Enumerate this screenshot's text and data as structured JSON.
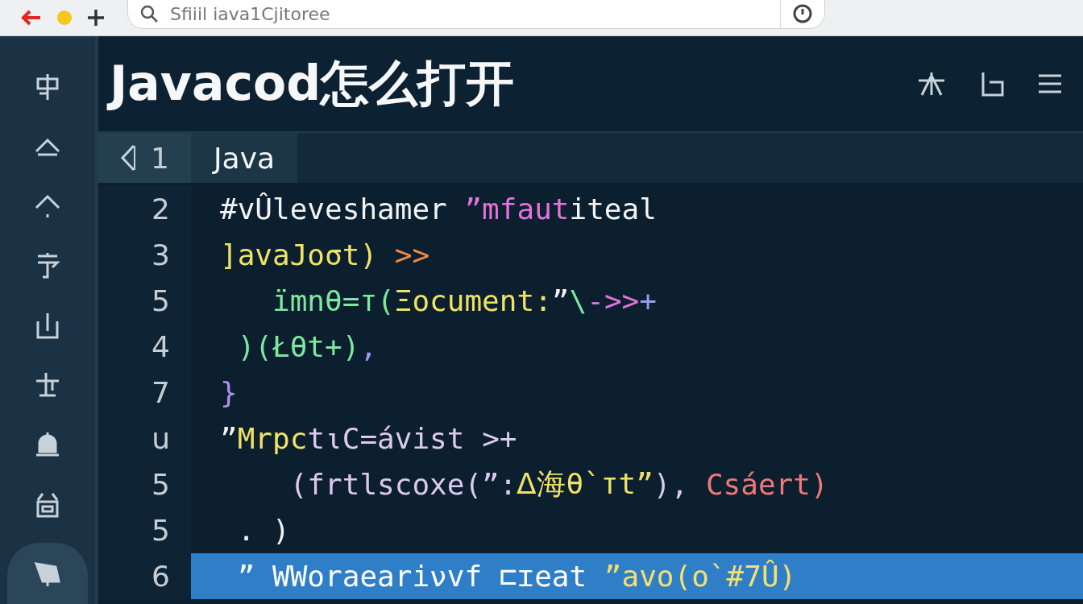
{
  "browser": {
    "address": "Sfiiil iava1Cjitoree"
  },
  "sidebar": {
    "items": [
      {
        "selected": false
      },
      {
        "selected": false
      },
      {
        "selected": false
      },
      {
        "selected": false
      },
      {
        "selected": false
      },
      {
        "selected": false
      },
      {
        "selected": false
      },
      {
        "selected": false
      },
      {
        "selected": true
      }
    ]
  },
  "header": {
    "title": "Javacod怎么打开"
  },
  "editor": {
    "first_line": "1",
    "tab": {
      "label": "Java",
      "selected": true
    },
    "lines": [
      {
        "number": "2",
        "selected": false,
        "tokens": [
          {
            "text": "#vÛleveshamer ",
            "color": "#f2f4f5"
          },
          {
            "text": "”mfaut",
            "color": "#e274dc"
          },
          {
            "text": "iteal",
            "color": "#f2f4f5"
          }
        ]
      },
      {
        "number": "3",
        "selected": false,
        "tokens": [
          {
            "text": "]avaJoσt) ",
            "color": "#f0e264"
          },
          {
            "text": ">>",
            "color": "#f08a4a"
          }
        ]
      },
      {
        "number": "5",
        "selected": false,
        "tokens": [
          {
            "text": "   ïmnθ=т(",
            "color": "#7ee8a0"
          },
          {
            "text": "Ξocument:",
            "color": "#f0e264"
          },
          {
            "text": "”",
            "color": "#f2f4f5"
          },
          {
            "text": "\\",
            "color": "#7ee8a0"
          },
          {
            "text": "->>",
            "color": "#e274dc"
          },
          {
            "text": "+",
            "color": "#9a9af0"
          }
        ]
      },
      {
        "number": "4",
        "selected": false,
        "tokens": [
          {
            "text": " )(Łθt+)",
            "color": "#7ee8a0"
          },
          {
            "text": ",",
            "color": "#9a9af0"
          }
        ]
      },
      {
        "number": "7",
        "selected": false,
        "tokens": [
          {
            "text": "}",
            "color": "#b090f0"
          }
        ]
      },
      {
        "number": "u",
        "selected": false,
        "tokens": [
          {
            "text": "”",
            "color": "#f2f4f5"
          },
          {
            "text": "Mrpc",
            "color": "#f0e264"
          },
          {
            "text": "tιC=ávist >+",
            "color": "#dcc8f0"
          }
        ]
      },
      {
        "number": "5",
        "selected": false,
        "tokens": [
          {
            "text": "    (frtlscoxe(”:",
            "color": "#dcc8f0"
          },
          {
            "text": "ᐃ海θ`тt”",
            "color": "#f0e264"
          },
          {
            "text": "), ",
            "color": "#dcc8f0"
          },
          {
            "text": "Csáert)",
            "color": "#f07878"
          }
        ]
      },
      {
        "number": "5",
        "selected": false,
        "tokens": [
          {
            "text": " . )",
            "color": "#f2f4f5"
          }
        ]
      },
      {
        "number": "6",
        "selected": true,
        "tokens": [
          {
            "text": " ” WWoraeariνvf ⊏ɪeat ",
            "color": "#ffffff"
          },
          {
            "text": "”avo(o`#7Û)",
            "color": "#f4e070"
          }
        ]
      }
    ]
  }
}
